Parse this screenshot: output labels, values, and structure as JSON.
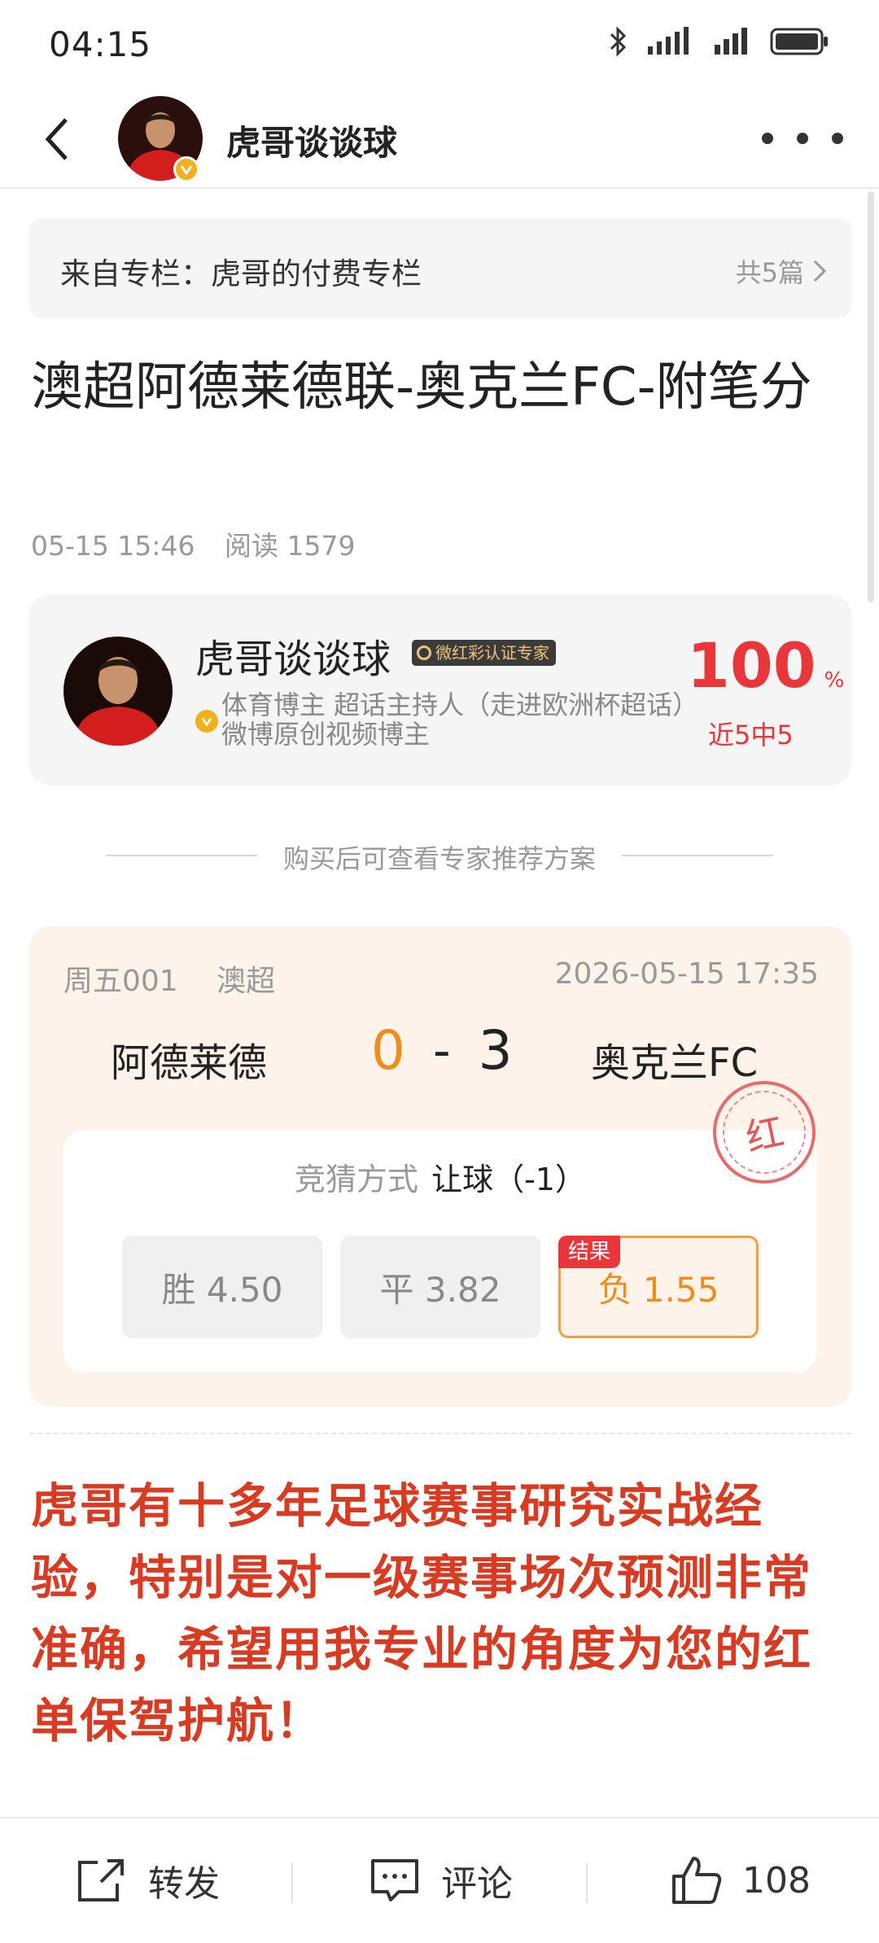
{
  "status_bar": {
    "time": "04:15",
    "battery_icon": "battery-icon",
    "signal_icon": "signal-icon",
    "bluetooth_icon": "bluetooth-icon"
  },
  "nav": {
    "back_icon": "chevron-left-icon",
    "title": "虎哥谈谈球",
    "more_icon": "more-dots-icon"
  },
  "column": {
    "label": "来自专栏：虎哥的付费专栏",
    "count": "共5篇"
  },
  "article": {
    "title": "澳超阿德莱德联-奥克兰FC-附笔分",
    "date": "05-15 15:46",
    "reads": "阅读 1579"
  },
  "expert": {
    "name": "虎哥谈谈球",
    "badge": "微红彩认证专家",
    "description": "体育博主 超话主持人（走进欧洲杯超话） 微博原创视频博主",
    "hit_rate": "100",
    "hit_rate_unit": "%",
    "hit_record": "近5中5"
  },
  "divider_text": "购买后可查看专家推荐方案",
  "match": {
    "code": "周五001",
    "league": "澳超",
    "datetime": "2026-05-15 17:35",
    "home_team": "阿德莱德",
    "away_team": "奥克兰FC",
    "home_score": "0",
    "score_sep": "-",
    "away_score": "3",
    "stamp": "红",
    "bet_type_label": "竞猜方式",
    "bet_type_value": "让球（-1）",
    "odds": [
      {
        "label": "胜 4.50"
      },
      {
        "label": "平 3.82"
      },
      {
        "label": "负 1.55",
        "result": "结果"
      }
    ]
  },
  "promo_text": "虎哥有十多年足球赛事研究实战经验，特别是对一级赛事场次预测非常准确，希望用我专业的角度为您的红单保驾护航！",
  "bottom_bar": {
    "share": "转发",
    "comment": "评论",
    "like_count": "108"
  },
  "colors": {
    "accent_red": "#e8363b",
    "orange": "#f08c1a",
    "promo_red": "#d93b22",
    "verify_gold": "#f2b01e"
  }
}
